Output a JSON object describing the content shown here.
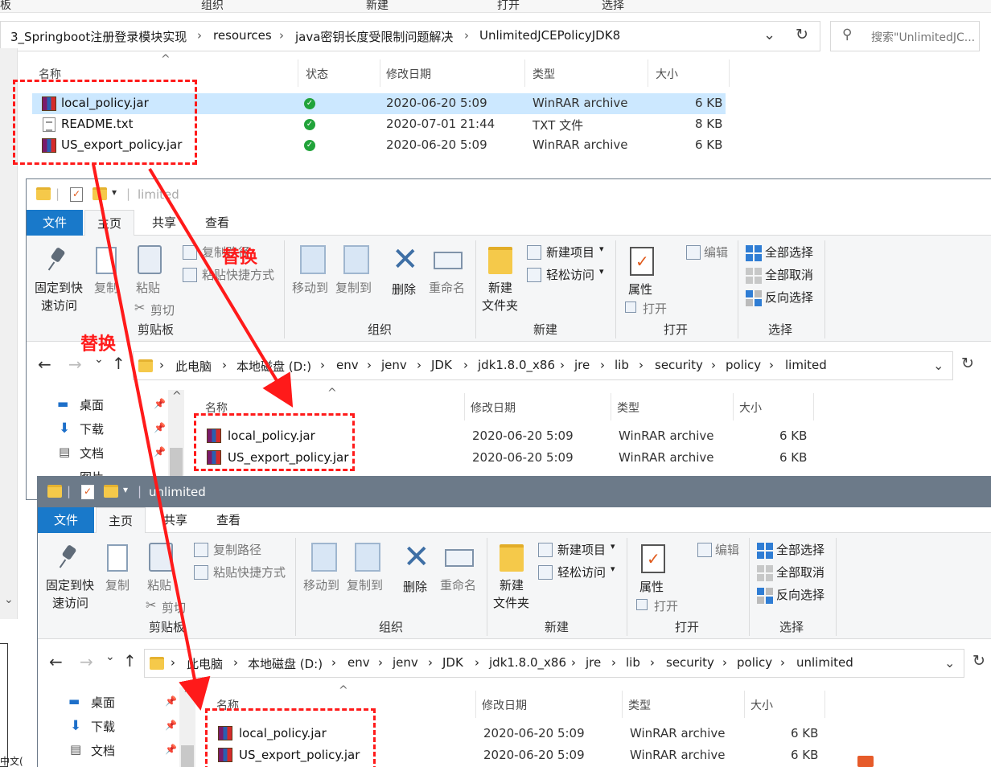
{
  "bg": {
    "ribbon_groups": [
      "板",
      "组织",
      "新建",
      "打开",
      "选择"
    ],
    "breadcrumb": [
      "3_Springboot注册登录模块实现",
      "resources",
      "java密钥长度受限制问题解决",
      "UnlimitedJCEPolicyJDK8"
    ],
    "search_placeholder": "搜索\"UnlimitedJC...",
    "columns": {
      "name": "名称",
      "status": "状态",
      "date": "修改日期",
      "type": "类型",
      "size": "大小"
    },
    "files": [
      {
        "name": "local_policy.jar",
        "date": "2020-06-20 5:09",
        "type": "WinRAR archive",
        "size": "6 KB"
      },
      {
        "name": "README.txt",
        "date": "2020-07-01 21:44",
        "type": "TXT 文件",
        "size": "8 KB"
      },
      {
        "name": "US_export_policy.jar",
        "date": "2020-06-20 5:09",
        "type": "WinRAR archive",
        "size": "6 KB"
      }
    ]
  },
  "ribbon": {
    "tabs": {
      "file": "文件",
      "home": "主页",
      "share": "共享",
      "view": "查看"
    },
    "pin": [
      "固定到快",
      "速访问"
    ],
    "copy": "复制",
    "paste": "粘贴",
    "copy_path": "复制路径",
    "paste_shortcut": "粘贴快捷方式",
    "cut": "剪切",
    "move_to": "移动到",
    "copy_to": "复制到",
    "delete": "删除",
    "rename": "重命名",
    "new_folder": [
      "新建",
      "文件夹"
    ],
    "new_item": "新建项目",
    "easy_access": "轻松访问",
    "properties": "属性",
    "open": "打开",
    "edit": "编辑",
    "select_all": "全部选择",
    "select_none": "全部取消",
    "invert_select": "反向选择",
    "groups": {
      "clipboard": "剪贴板",
      "organize": "组织",
      "new": "新建",
      "open": "打开",
      "select": "选择"
    }
  },
  "sidebar": [
    "桌面",
    "下载",
    "文档",
    "图片"
  ],
  "win2": {
    "title": "limited",
    "breadcrumb": [
      "此电脑",
      "本地磁盘 (D:)",
      "env",
      "jenv",
      "JDK",
      "jdk1.8.0_x86",
      "jre",
      "lib",
      "security",
      "policy",
      "limited"
    ],
    "columns": {
      "name": "名称",
      "date": "修改日期",
      "type": "类型",
      "size": "大小"
    },
    "files": [
      {
        "name": "local_policy.jar",
        "date": "2020-06-20 5:09",
        "type": "WinRAR archive",
        "size": "6 KB"
      },
      {
        "name": "US_export_policy.jar",
        "date": "2020-06-20 5:09",
        "type": "WinRAR archive",
        "size": "6 KB"
      }
    ]
  },
  "win3": {
    "title": "unlimited",
    "breadcrumb": [
      "此电脑",
      "本地磁盘 (D:)",
      "env",
      "jenv",
      "JDK",
      "jdk1.8.0_x86",
      "jre",
      "lib",
      "security",
      "policy",
      "unlimited"
    ],
    "columns": {
      "name": "名称",
      "date": "修改日期",
      "type": "类型",
      "size": "大小"
    },
    "files": [
      {
        "name": "local_policy.jar",
        "date": "2020-06-20 5:09",
        "type": "WinRAR archive",
        "size": "6 KB"
      },
      {
        "name": "US_export_policy.jar",
        "date": "2020-06-20 5:09",
        "type": "WinRAR archive",
        "size": "6 KB"
      }
    ]
  },
  "annotations": {
    "replace": "替换"
  },
  "colors": {
    "annotation": "#ff1a1a",
    "file_tab": "#1979ca",
    "selected_row": "#cce8ff",
    "titlebar_inactive": "#6c7a89"
  }
}
